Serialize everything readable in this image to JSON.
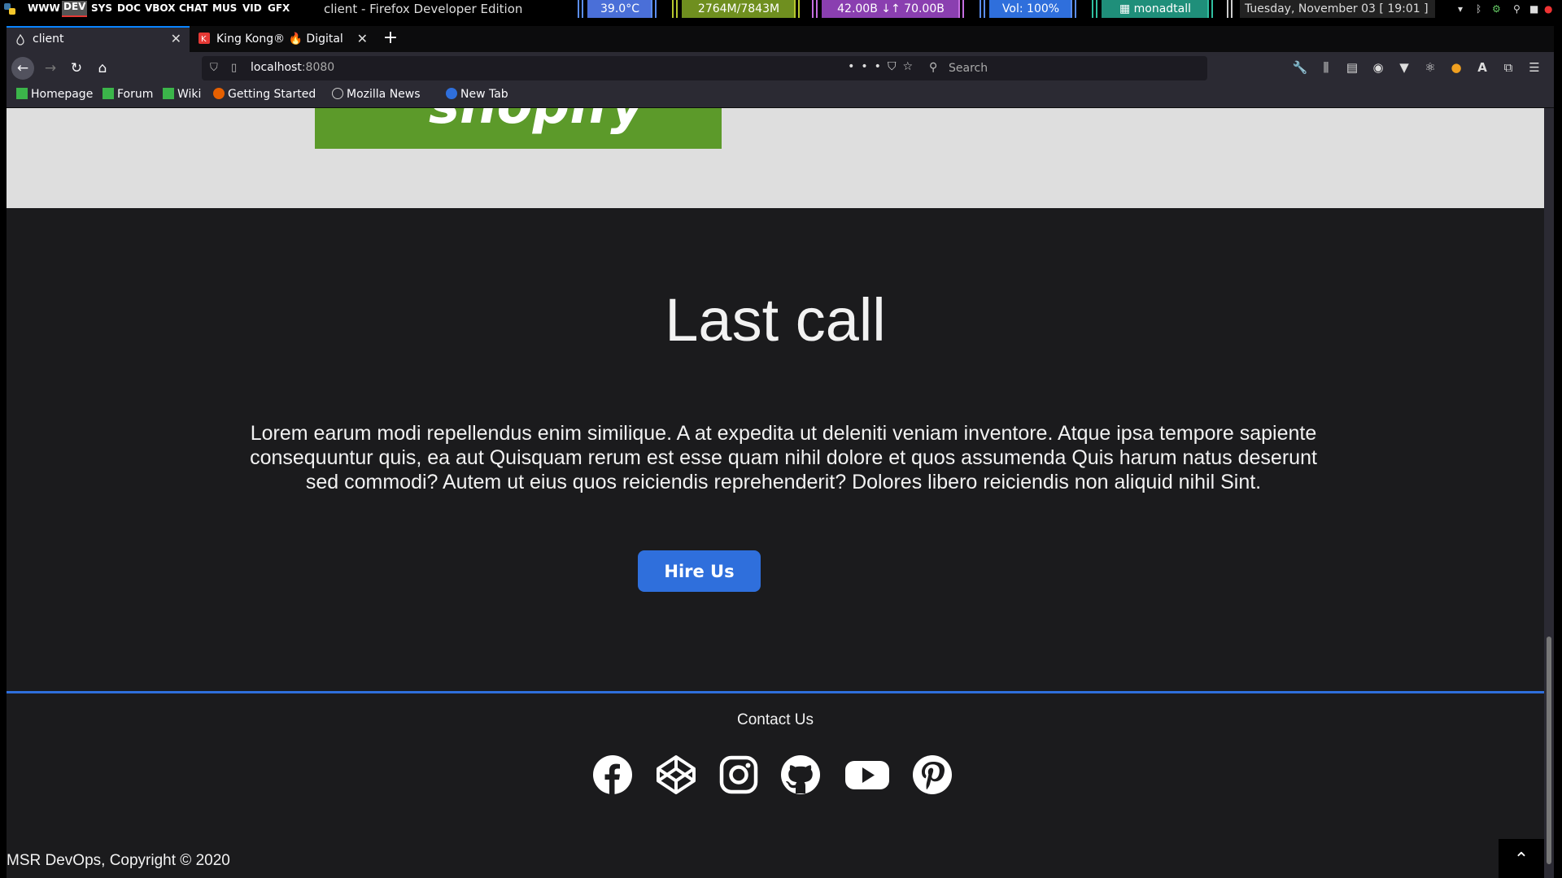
{
  "system_bar": {
    "workspaces": [
      "WWW",
      "DEV",
      "SYS",
      "DOC",
      "VBOX",
      "CHAT",
      "MUS",
      "VID",
      "GFX"
    ],
    "active_workspace": "DEV",
    "window_title": "client - Firefox Developer Edition",
    "widgets": {
      "temperature": "39.0°C",
      "memory": "2764M/7843M",
      "network": "42.00B ↓↑ 70.00B",
      "volume": "Vol: 100%",
      "layout": "monadtall",
      "datetime": "Tuesday, November 03  [ 19:01 ]"
    }
  },
  "browser": {
    "tabs": [
      {
        "label": "client",
        "active": true
      },
      {
        "label": "King Kong® 🔥 Digital Di",
        "active": false
      }
    ],
    "url": {
      "host": "localhost",
      "port": ":8080"
    },
    "search_placeholder": "Search",
    "bookmarks": [
      "Homepage",
      "Forum",
      "Wiki",
      "Getting Started",
      "Mozilla News",
      "New Tab"
    ]
  },
  "page": {
    "prev_logo_text": "shopify",
    "cta": {
      "title": "Last call",
      "body": "Lorem earum modi repellendus enim similique. A at expedita ut deleniti veniam inventore. Atque ipsa tempore sapiente consequuntur quis, ea aut Quisquam rerum est esse quam nihil dolore et quos assumenda Quis harum natus deserunt sed commodi? Autem ut eius quos reiciendis reprehenderit? Dolores libero reiciendis non aliquid nihil Sint.",
      "button_label": "Hire Us"
    },
    "footer": {
      "contact_label": "Contact Us",
      "socials": [
        "facebook-icon",
        "codepen-icon",
        "instagram-icon",
        "github-icon",
        "youtube-icon",
        "pinterest-icon"
      ],
      "copyright": "MSR DevOps, Copyright © 2020"
    }
  },
  "colors": {
    "accent": "#2f6fdc",
    "page_bg": "#1b1b1d",
    "light_section": "#dedede",
    "shopify_green": "#5c9a2a"
  }
}
